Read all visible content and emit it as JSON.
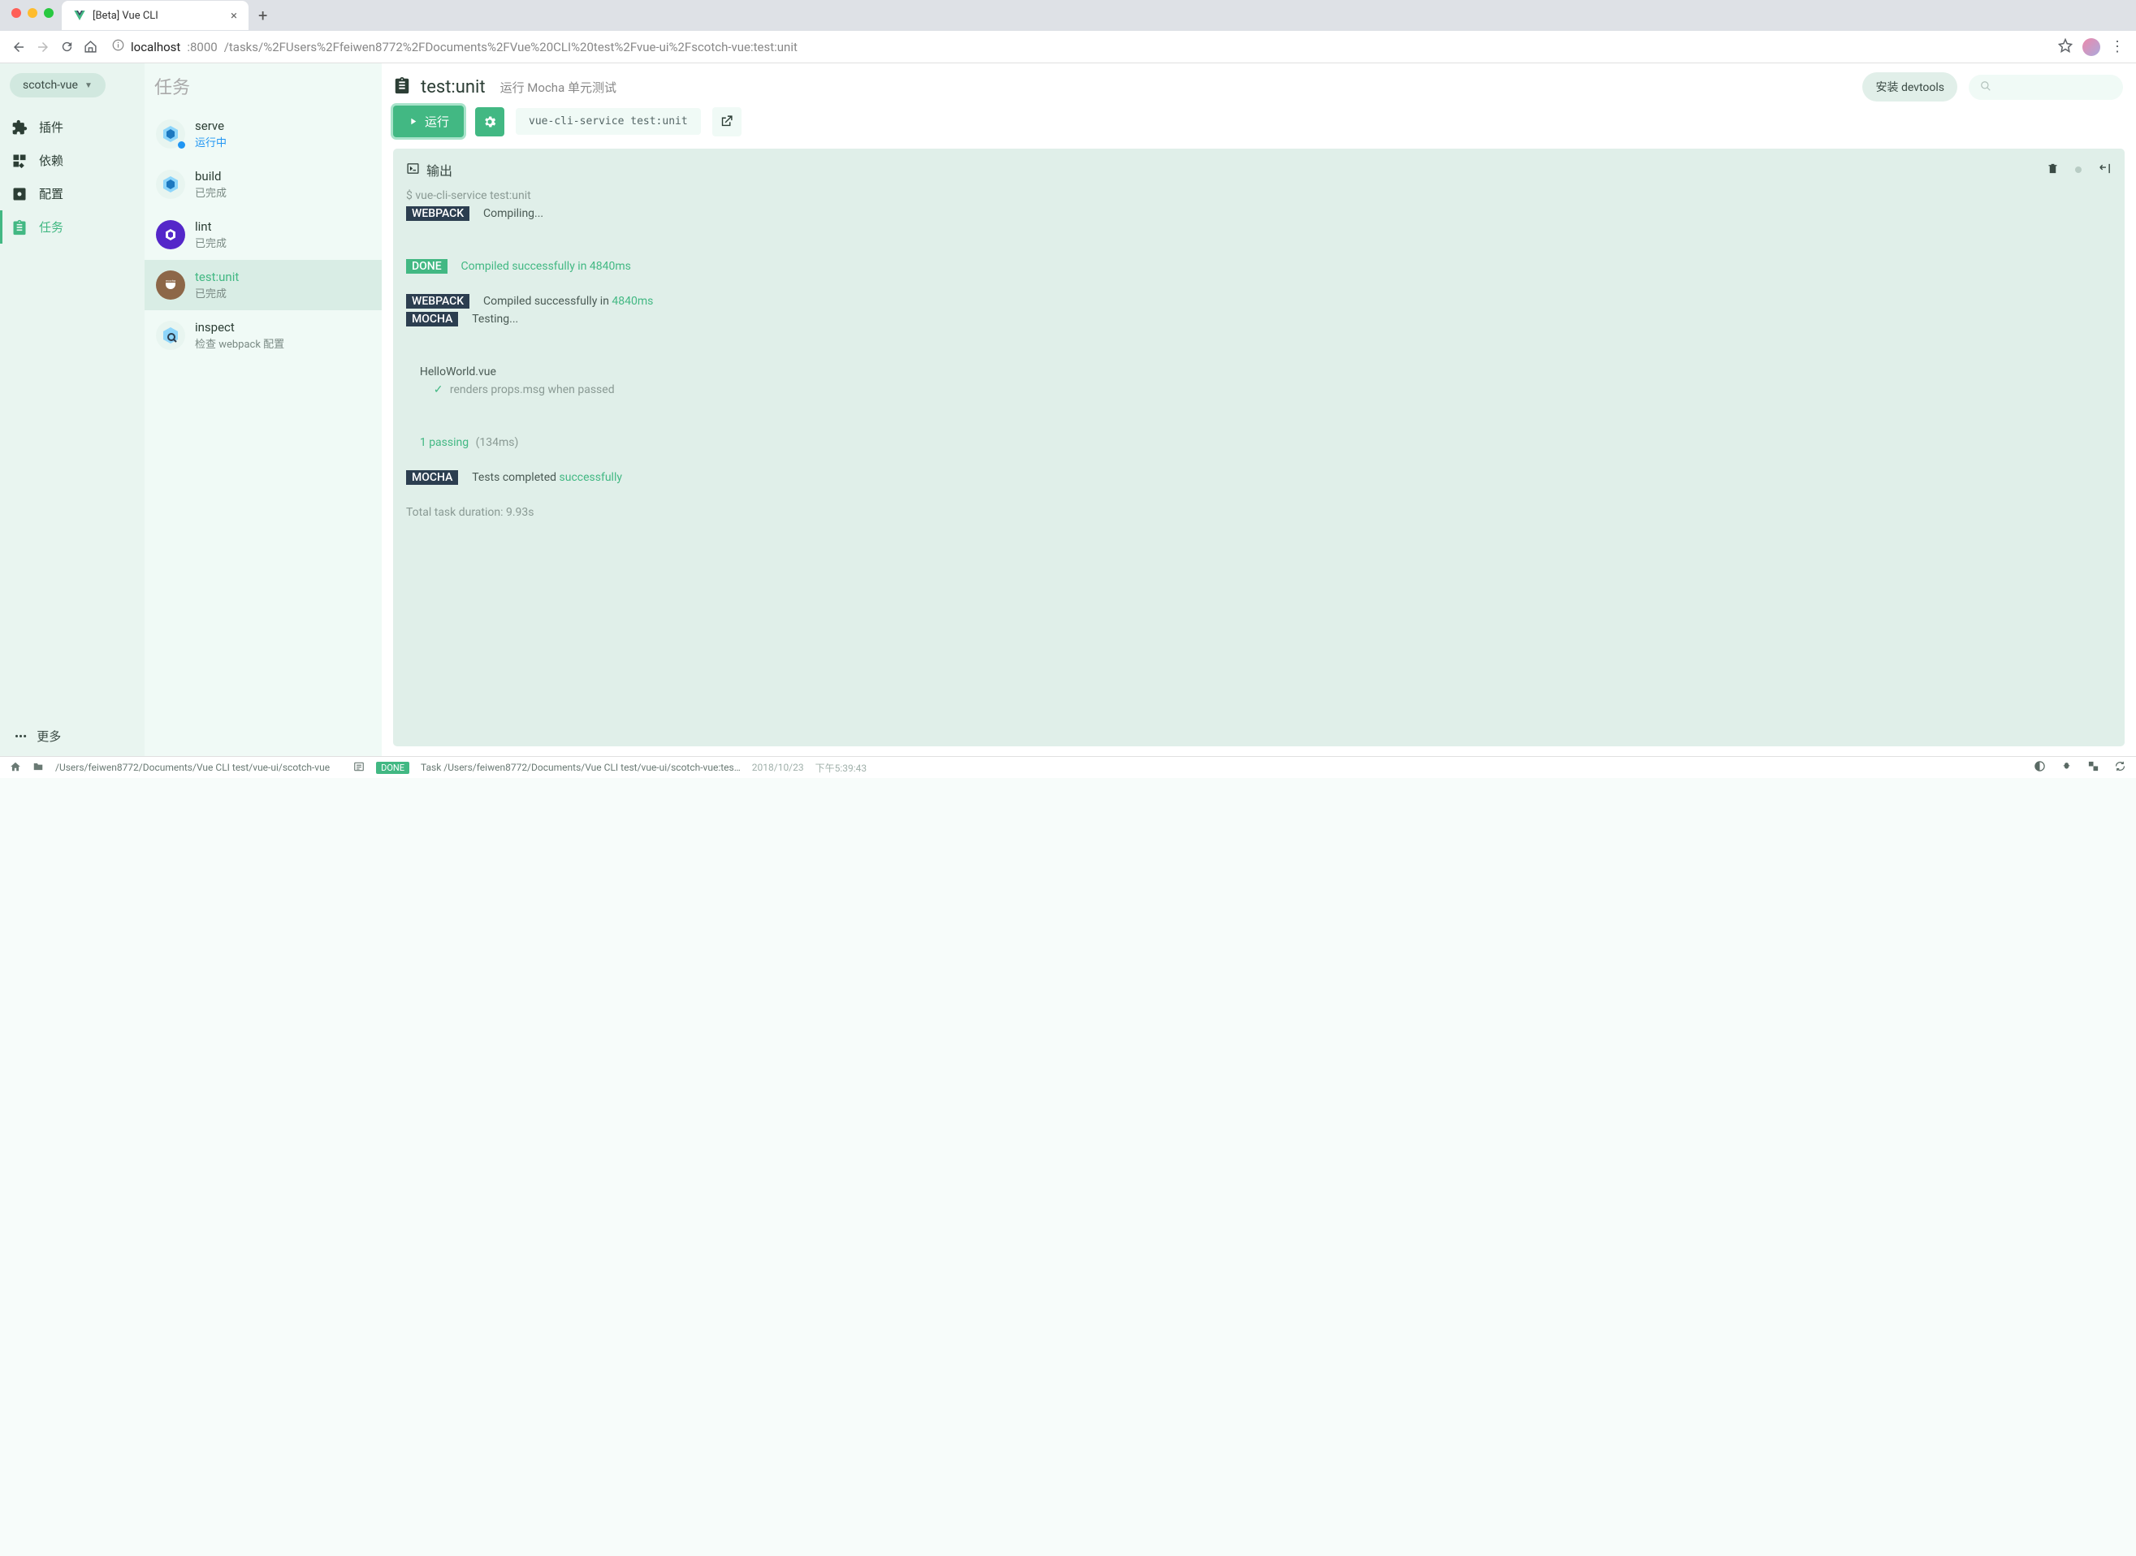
{
  "browser": {
    "tab_title": "[Beta] Vue CLI",
    "url_host": "localhost",
    "url_port": ":8000",
    "url_path": "/tasks/%2FUsers%2Ffeiwen8772%2FDocuments%2FVue%20CLI%20test%2Fvue-ui%2Fscotch-vue:test:unit"
  },
  "header": {
    "project_name": "scotch-vue",
    "page_title_zh": "任务",
    "install_devtools": "安装 devtools"
  },
  "sidebar": {
    "items": [
      {
        "label": "插件",
        "icon": "puzzle"
      },
      {
        "label": "依赖",
        "icon": "widgets"
      },
      {
        "label": "配置",
        "icon": "settings-app"
      },
      {
        "label": "任务",
        "icon": "clipboard",
        "active": true
      }
    ],
    "more": "更多"
  },
  "tasks": [
    {
      "name": "serve",
      "status": "运行中",
      "status_type": "running",
      "icon": "webpack"
    },
    {
      "name": "build",
      "status": "已完成",
      "status_type": "done",
      "icon": "webpack"
    },
    {
      "name": "lint",
      "status": "已完成",
      "status_type": "done",
      "icon": "lint"
    },
    {
      "name": "test:unit",
      "status": "已完成",
      "status_type": "done",
      "icon": "mocha",
      "active": true
    },
    {
      "name": "inspect",
      "status": "检查 webpack 配置",
      "status_type": "info",
      "icon": "inspect"
    }
  ],
  "task_detail": {
    "title": "test:unit",
    "description": "运行 Mocha 单元测试",
    "run_button": "运行",
    "command": "vue-cli-service test:unit"
  },
  "output": {
    "title": "输出",
    "cmd_line": "$ vue-cli-service test:unit",
    "webpack_compiling": "Compiling...",
    "done_msg": "Compiled successfully in 4840ms",
    "webpack_compiled_prefix": "Compiled successfully in ",
    "webpack_compiled_time": "4840ms",
    "mocha_testing": "Testing...",
    "test_file": "HelloWorld.vue",
    "test_case": "renders props.msg when passed",
    "passing_count": "1 passing",
    "passing_time": "(134ms)",
    "mocha_done_prefix": "Tests completed ",
    "mocha_done_word": "successfully",
    "total_duration": "Total task duration: 9.93s",
    "tag_webpack": "WEBPACK",
    "tag_done": "DONE",
    "tag_mocha": "MOCHA"
  },
  "status_bar": {
    "project_path": "/Users/feiwen8772/Documents/Vue CLI test/vue-ui/scotch-vue",
    "done": "DONE",
    "task_msg": "Task /Users/feiwen8772/Documents/Vue CLI test/vue-ui/scotch-vue:tes…",
    "date": "2018/10/23",
    "time": "下午5:39:43"
  }
}
